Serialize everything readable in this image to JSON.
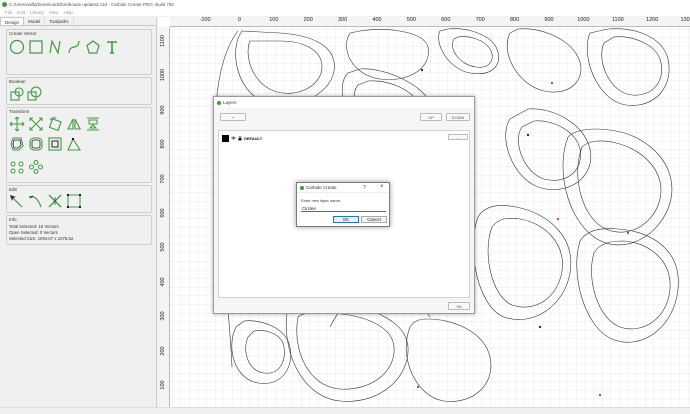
{
  "window": {
    "title": "C:/Users/willa/Downloads/birdhouse updated.c2d - Carbide Create PRO, Build 760"
  },
  "menu": [
    "File",
    "Edit",
    "Library",
    "View",
    "Help"
  ],
  "left_panel": {
    "tabs": [
      "Design",
      "Model",
      "Toolpaths"
    ],
    "sections": {
      "create_vector": "Create Vector",
      "boolean": "Boolean",
      "transform": "Transform",
      "edit": "Edit",
      "info": "Info"
    },
    "info": {
      "total_selected": "Total Selected:  15 Vectors",
      "open_selected": "Open Selected:  0 Vectors",
      "selected_size": "Selected Size:    1094.07 x 1075.62"
    },
    "accent_color": "#3f9b3f"
  },
  "rulers": {
    "horizontal": [
      "-100",
      "0",
      "100",
      "200",
      "300",
      "400",
      "500",
      "600",
      "700",
      "800",
      "900",
      "1000",
      "1100",
      "1200",
      "1300"
    ],
    "vertical": [
      "1100",
      "1000",
      "900",
      "800",
      "700",
      "600",
      "500",
      "400",
      "300",
      "200",
      "100"
    ]
  },
  "layers_dialog": {
    "title": "Layers",
    "add_label": "+",
    "up_label": "UP",
    "down_label": "DOWN",
    "extra_label": "...",
    "layer_name": "DEFAULT",
    "ok_label": "Ok"
  },
  "prompt_dialog": {
    "title": "Carbide Create",
    "help_label": "?",
    "close_label": "×",
    "prompt": "Enter new layer name:",
    "value": "Circles",
    "ok_label": "OK",
    "cancel_label": "Cancel"
  }
}
